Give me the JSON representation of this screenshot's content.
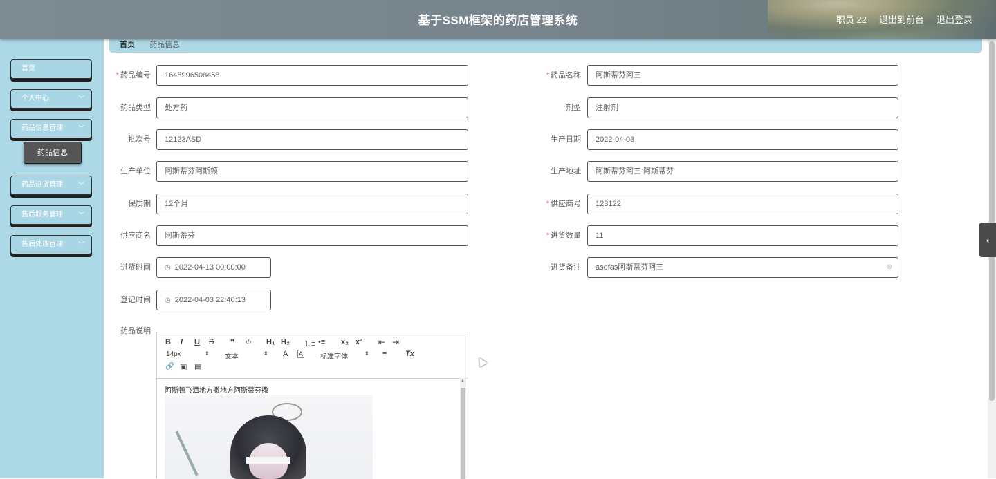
{
  "header": {
    "title": "基于SSM框架的药店管理系统",
    "user": "职员 22",
    "front_link": "退出到前台",
    "logout": "退出登录"
  },
  "sidebar": {
    "items": [
      {
        "label": "首页",
        "has_chevron": false
      },
      {
        "label": "个人中心",
        "has_chevron": true
      },
      {
        "label": "药品信息管理",
        "has_chevron": true
      },
      {
        "label": "药品进货管理",
        "has_chevron": true
      },
      {
        "label": "售后服务管理",
        "has_chevron": true
      },
      {
        "label": "售后处理管理",
        "has_chevron": true
      }
    ],
    "submenu_active": "药品信息"
  },
  "breadcrumb": {
    "home": "首页",
    "separator": "/",
    "current": "药品信息"
  },
  "form": {
    "drug_code": {
      "label": "药品编号",
      "value": "1648996508458",
      "required": true
    },
    "drug_name": {
      "label": "药品名称",
      "value": "阿斯蒂芬阿三",
      "required": true
    },
    "drug_type": {
      "label": "药品类型",
      "value": "处方药"
    },
    "dosage_form": {
      "label": "剂型",
      "value": "注射剂"
    },
    "batch_no": {
      "label": "批次号",
      "value": "12123ASD"
    },
    "prod_date": {
      "label": "生产日期",
      "value": "2022-04-03"
    },
    "manufacturer": {
      "label": "生产单位",
      "value": "阿斯蒂芬阿斯顿"
    },
    "prod_address": {
      "label": "生产地址",
      "value": "阿斯蒂芬阿三 阿斯蒂芬"
    },
    "shelf_life": {
      "label": "保质期",
      "value": "12个月"
    },
    "supplier_no": {
      "label": "供应商号",
      "value": "123122",
      "required": true
    },
    "supplier_name": {
      "label": "供应商名",
      "value": "阿斯蒂芬"
    },
    "purchase_qty": {
      "label": "进货数量",
      "value": "11",
      "required": true
    },
    "purchase_time": {
      "label": "进货时间",
      "value": "2022-04-13 00:00:00"
    },
    "purchase_note": {
      "label": "进货备注",
      "value": "asdfas阿斯蒂芬阿三"
    },
    "register_time": {
      "label": "登记时间",
      "value": "2022-04-03 22:40:13"
    },
    "description": {
      "label": "药品说明",
      "text": "阿斯顿飞洒地方撒地方阿斯蒂芬撒"
    }
  },
  "editor_toolbar": {
    "bold": "B",
    "italic": "I",
    "underline": "U",
    "strike": "S",
    "quote": "❞",
    "code": "‹/›",
    "h1": "H₁",
    "h2": "H₂",
    "ol": "⒈≡",
    "ul": "•≡",
    "sub": "x₂",
    "sup": "x²",
    "indent_out": "⇤",
    "indent_in": "⇥",
    "size": "14px",
    "para": "文本",
    "font_color": "A",
    "bg_color": "A",
    "font": "标准字体",
    "align": "≡",
    "clear": "Tx",
    "link": "🔗",
    "image": "▣",
    "video": "▤"
  },
  "side_tab": "‹",
  "colors": {
    "accent": "#add8e6",
    "required": "#f56c6c"
  }
}
